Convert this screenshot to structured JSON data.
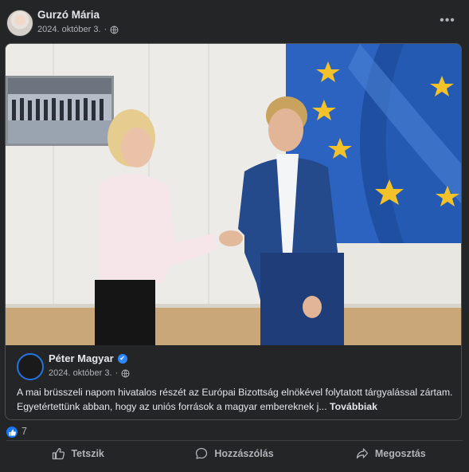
{
  "post": {
    "author_name": "Gurzó Mária",
    "date": "2024. október 3.",
    "separator": "·",
    "more_icon": "more-dots-icon",
    "audience_icon": "globe-icon"
  },
  "shared": {
    "author_name": "Péter Magyar",
    "verified_icon": "verified-badge-icon",
    "date": "2024. október 3.",
    "separator": "·",
    "text": "A mai brüsszeli napom hivatalos részét az Európai Bizottság elnökével folytatott tárgyalással zártam. Egyetértettünk abban, hogy az uniós források a magyar embereknek j...",
    "see_more": "Továbbiak"
  },
  "reactions": {
    "icon": "like-reaction-icon",
    "count": "7"
  },
  "actions": {
    "like": "Tetszik",
    "comment": "Hozzászólás",
    "share": "Megosztás"
  },
  "colors": {
    "background": "#242526",
    "text": "#e4e6eb",
    "secondary_text": "#b0b3b8",
    "accent": "#2d88ff",
    "like_blue": "#1877f2"
  }
}
